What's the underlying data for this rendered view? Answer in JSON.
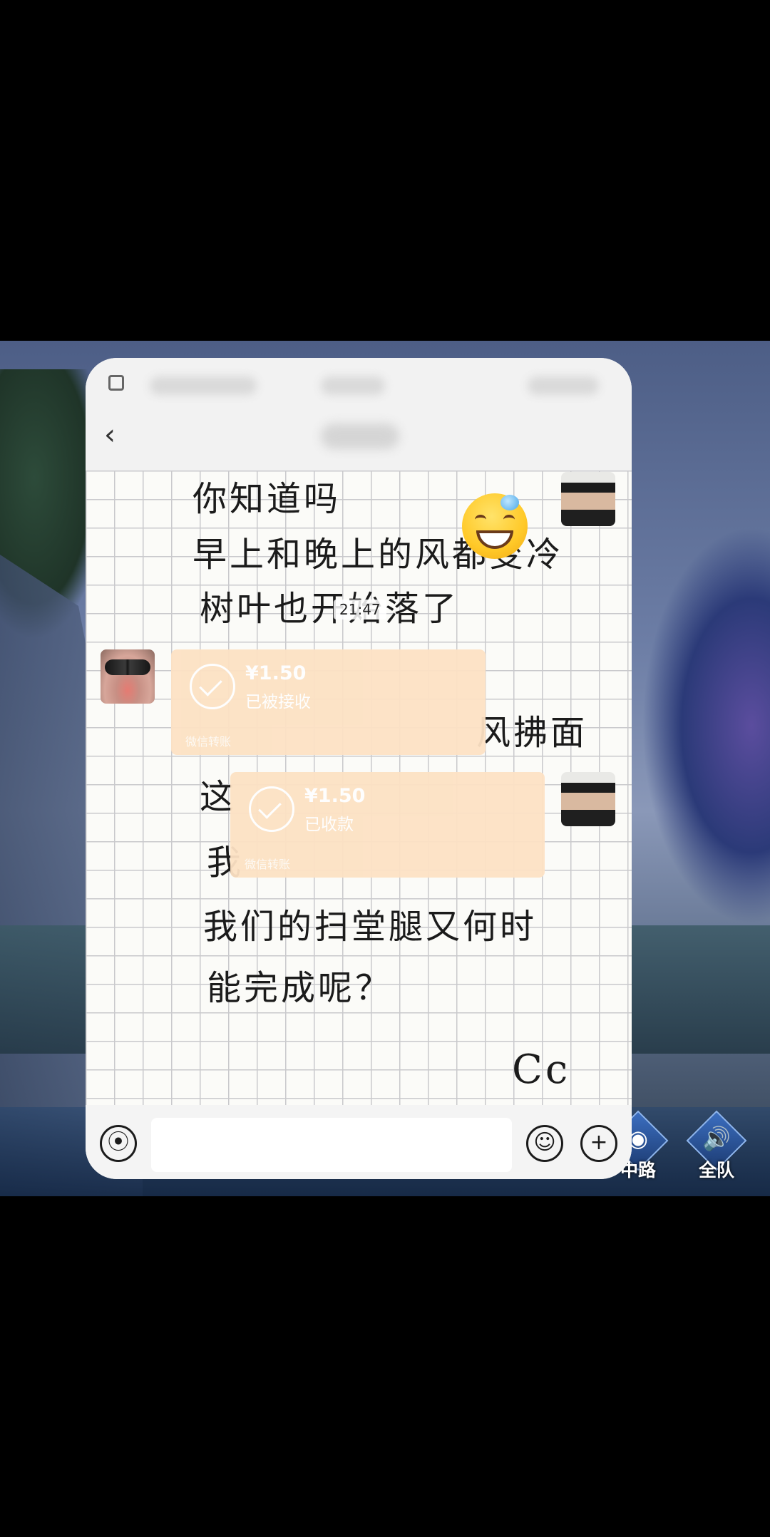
{
  "chat": {
    "time_label": "21:47",
    "handwritten_lines": [
      "你知道吗",
      "早上和晚上的风都变冷",
      "树叶也开始落了",
      "风拂面",
      "这",
      "我",
      "我们的扫堂腿又何时",
      "能完成呢？",
      "Cc"
    ],
    "transfers": [
      {
        "amount": "¥1.50",
        "status": "已被接收",
        "footer": "微信转账"
      },
      {
        "amount": "¥1.50",
        "status": "已收款",
        "footer": "微信转账"
      }
    ]
  },
  "game_hud": {
    "buttons": [
      {
        "label": "中路",
        "icon": "signal-icon"
      },
      {
        "label": "全队",
        "icon": "speaker-icon"
      }
    ]
  },
  "colors": {
    "transfer_bg": "#fde2c4",
    "panel_bg": "#f4f4f4"
  }
}
